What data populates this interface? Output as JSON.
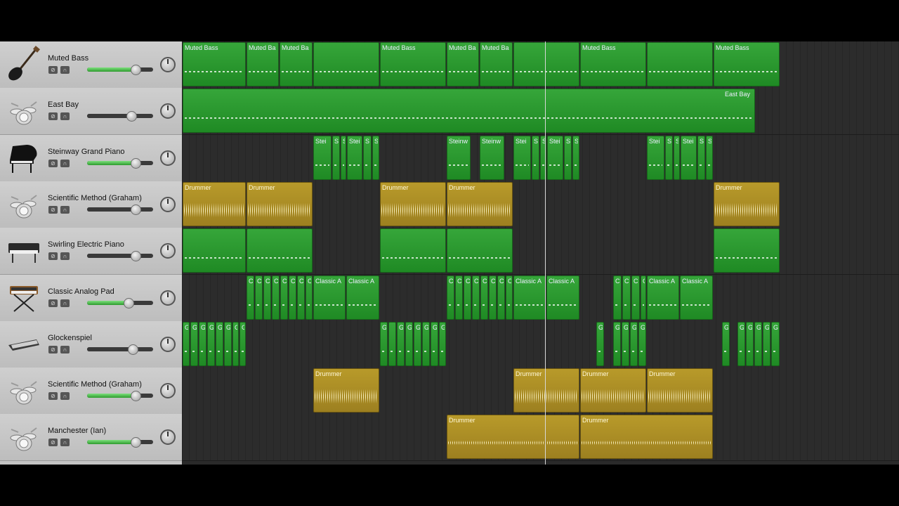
{
  "tracks": [
    {
      "name": "Muted Bass",
      "icon": "bass-guitar-icon",
      "volume": 0.72,
      "volume_color": "#44c444"
    },
    {
      "name": "East Bay",
      "icon": "drum-kit-icon",
      "volume": 0.66,
      "volume_color": "#3a3a3a"
    },
    {
      "name": "Steinway Grand Piano",
      "icon": "grand-piano-icon",
      "volume": 0.72,
      "volume_color": "#44c444"
    },
    {
      "name": "Scientific Method (Graham)",
      "icon": "drum-kit-icon",
      "volume": 0.72,
      "volume_color": "#3a3a3a"
    },
    {
      "name": "Swirling Electric Piano",
      "icon": "electric-piano-icon",
      "volume": 0.72,
      "volume_color": "#3a3a3a"
    },
    {
      "name": "Classic Analog Pad",
      "icon": "synth-keyboard-icon",
      "volume": 0.62,
      "volume_color": "#44c444"
    },
    {
      "name": "Glockenspiel",
      "icon": "glockenspiel-icon",
      "volume": 0.68,
      "volume_color": "#3a3a3a"
    },
    {
      "name": "Scientific Method (Graham)",
      "icon": "drum-kit-icon",
      "volume": 0.72,
      "volume_color": "#44c444"
    },
    {
      "name": "Manchester (Ian)",
      "icon": "drum-kit-icon",
      "volume": 0.72,
      "volume_color": "#44c444"
    }
  ],
  "regions": [
    [
      {
        "label": "Muted Bass",
        "type": "green",
        "start": 0,
        "end": 90
      },
      {
        "label": "Muted Ba",
        "type": "green",
        "start": 91,
        "end": 137
      },
      {
        "label": "Muted Ba",
        "type": "green",
        "start": 138,
        "end": 185
      },
      {
        "label": "",
        "type": "green",
        "start": 186,
        "end": 280
      },
      {
        "label": "Muted Bass",
        "type": "green",
        "start": 281,
        "end": 375
      },
      {
        "label": "Muted Ba",
        "type": "green",
        "start": 376,
        "end": 422
      },
      {
        "label": "Muted Ba",
        "type": "green",
        "start": 423,
        "end": 470
      },
      {
        "label": "",
        "type": "green",
        "start": 471,
        "end": 565
      },
      {
        "label": "Muted Bass",
        "type": "green",
        "start": 566,
        "end": 660
      },
      {
        "label": "",
        "type": "green",
        "start": 661,
        "end": 755
      },
      {
        "label": "Muted Bass",
        "type": "green",
        "start": 756,
        "end": 850
      }
    ],
    [
      {
        "label": "East Bay",
        "type": "green",
        "start": 0,
        "end": 815,
        "label_right": true
      }
    ],
    [
      {
        "label": "Stei",
        "type": "green",
        "start": 186,
        "end": 212
      },
      {
        "label": "S",
        "type": "green",
        "start": 213,
        "end": 224
      },
      {
        "label": "S",
        "type": "green",
        "start": 225,
        "end": 233
      },
      {
        "label": "Stei",
        "type": "green",
        "start": 234,
        "end": 256
      },
      {
        "label": "S",
        "type": "green",
        "start": 257,
        "end": 269
      },
      {
        "label": "S",
        "type": "green",
        "start": 270,
        "end": 280
      },
      {
        "label": "Steinw",
        "type": "green",
        "start": 376,
        "end": 410
      },
      {
        "label": "Steinw",
        "type": "green",
        "start": 423,
        "end": 458
      },
      {
        "label": "Stei",
        "type": "green",
        "start": 471,
        "end": 496
      },
      {
        "label": "S",
        "type": "green",
        "start": 497,
        "end": 508
      },
      {
        "label": "S",
        "type": "green",
        "start": 509,
        "end": 518
      },
      {
        "label": "Stei",
        "type": "green",
        "start": 519,
        "end": 542
      },
      {
        "label": "S",
        "type": "green",
        "start": 543,
        "end": 554
      },
      {
        "label": "S",
        "type": "green",
        "start": 555,
        "end": 565
      },
      {
        "label": "Stei",
        "type": "green",
        "start": 661,
        "end": 686
      },
      {
        "label": "S",
        "type": "green",
        "start": 687,
        "end": 698
      },
      {
        "label": "S",
        "type": "green",
        "start": 699,
        "end": 708
      },
      {
        "label": "Stei",
        "type": "green",
        "start": 709,
        "end": 732
      },
      {
        "label": "S",
        "type": "green",
        "start": 733,
        "end": 744
      },
      {
        "label": "S",
        "type": "green",
        "start": 745,
        "end": 755
      }
    ],
    [
      {
        "label": "Drummer",
        "type": "gold",
        "start": 0,
        "end": 90
      },
      {
        "label": "Drummer",
        "type": "gold",
        "start": 91,
        "end": 185
      },
      {
        "label": "Drummer",
        "type": "gold",
        "start": 281,
        "end": 375
      },
      {
        "label": "Drummer",
        "type": "gold",
        "start": 376,
        "end": 470
      },
      {
        "label": "Drummer",
        "type": "gold",
        "start": 756,
        "end": 850
      }
    ],
    [
      {
        "label": "",
        "type": "green",
        "start": 0,
        "end": 90
      },
      {
        "label": "",
        "type": "green",
        "start": 91,
        "end": 185
      },
      {
        "label": "",
        "type": "green",
        "start": 281,
        "end": 375
      },
      {
        "label": "",
        "type": "green",
        "start": 376,
        "end": 470
      },
      {
        "label": "",
        "type": "green",
        "start": 756,
        "end": 850
      }
    ],
    [
      {
        "label": "C",
        "type": "green",
        "start": 91,
        "end": 102
      },
      {
        "label": "C",
        "type": "green",
        "start": 103,
        "end": 114
      },
      {
        "label": "C",
        "type": "green",
        "start": 115,
        "end": 126
      },
      {
        "label": "C",
        "type": "green",
        "start": 127,
        "end": 138
      },
      {
        "label": "C",
        "type": "green",
        "start": 139,
        "end": 150
      },
      {
        "label": "C",
        "type": "green",
        "start": 151,
        "end": 162
      },
      {
        "label": "C",
        "type": "green",
        "start": 163,
        "end": 174
      },
      {
        "label": "C",
        "type": "green",
        "start": 175,
        "end": 185
      },
      {
        "label": "Classic A",
        "type": "green",
        "start": 186,
        "end": 232
      },
      {
        "label": "Classic A",
        "type": "green",
        "start": 233,
        "end": 280
      },
      {
        "label": "C",
        "type": "green",
        "start": 376,
        "end": 387
      },
      {
        "label": "C",
        "type": "green",
        "start": 388,
        "end": 399
      },
      {
        "label": "C",
        "type": "green",
        "start": 400,
        "end": 411
      },
      {
        "label": "C",
        "type": "green",
        "start": 412,
        "end": 423
      },
      {
        "label": "C",
        "type": "green",
        "start": 424,
        "end": 435
      },
      {
        "label": "C",
        "type": "green",
        "start": 436,
        "end": 447
      },
      {
        "label": "C",
        "type": "green",
        "start": 448,
        "end": 459
      },
      {
        "label": "C",
        "type": "green",
        "start": 460,
        "end": 470
      },
      {
        "label": "Classic A",
        "type": "green",
        "start": 471,
        "end": 517
      },
      {
        "label": "Classic A",
        "type": "green",
        "start": 518,
        "end": 565
      },
      {
        "label": "C",
        "type": "green",
        "start": 613,
        "end": 625
      },
      {
        "label": "C",
        "type": "green",
        "start": 626,
        "end": 638
      },
      {
        "label": "C",
        "type": "green",
        "start": 639,
        "end": 651
      },
      {
        "label": "C",
        "type": "green",
        "start": 652,
        "end": 660
      },
      {
        "label": "Classic A",
        "type": "green",
        "start": 661,
        "end": 707
      },
      {
        "label": "Classic A",
        "type": "green",
        "start": 708,
        "end": 755
      }
    ],
    [
      {
        "label": "G",
        "type": "green",
        "start": 0,
        "end": 10
      },
      {
        "label": "G",
        "type": "green",
        "start": 11,
        "end": 22
      },
      {
        "label": "G",
        "type": "green",
        "start": 23,
        "end": 34
      },
      {
        "label": "G",
        "type": "green",
        "start": 35,
        "end": 46
      },
      {
        "label": "G",
        "type": "green",
        "start": 47,
        "end": 58
      },
      {
        "label": "G",
        "type": "green",
        "start": 59,
        "end": 70
      },
      {
        "label": "G",
        "type": "green",
        "start": 71,
        "end": 80
      },
      {
        "label": "G",
        "type": "green",
        "start": 81,
        "end": 90
      },
      {
        "label": "G",
        "type": "green",
        "start": 281,
        "end": 292
      },
      {
        "label": "",
        "type": "green",
        "start": 293,
        "end": 304
      },
      {
        "label": "G",
        "type": "green",
        "start": 305,
        "end": 316
      },
      {
        "label": "G",
        "type": "green",
        "start": 317,
        "end": 328
      },
      {
        "label": "G",
        "type": "green",
        "start": 329,
        "end": 340
      },
      {
        "label": "G",
        "type": "green",
        "start": 341,
        "end": 352
      },
      {
        "label": "G",
        "type": "green",
        "start": 353,
        "end": 364
      },
      {
        "label": "G",
        "type": "green",
        "start": 365,
        "end": 375
      },
      {
        "label": "G",
        "type": "green",
        "start": 589,
        "end": 600
      },
      {
        "label": "G",
        "type": "green",
        "start": 613,
        "end": 624
      },
      {
        "label": "G",
        "type": "green",
        "start": 625,
        "end": 636
      },
      {
        "label": "G",
        "type": "green",
        "start": 637,
        "end": 648
      },
      {
        "label": "G",
        "type": "green",
        "start": 649,
        "end": 660
      },
      {
        "label": "G",
        "type": "green",
        "start": 768,
        "end": 779
      },
      {
        "label": "G",
        "type": "green",
        "start": 790,
        "end": 801
      },
      {
        "label": "G",
        "type": "green",
        "start": 802,
        "end": 813
      },
      {
        "label": "G",
        "type": "green",
        "start": 814,
        "end": 825
      },
      {
        "label": "G",
        "type": "green",
        "start": 826,
        "end": 837
      },
      {
        "label": "G",
        "type": "green",
        "start": 838,
        "end": 850
      }
    ],
    [
      {
        "label": "Drummer",
        "type": "gold",
        "start": 186,
        "end": 280
      },
      {
        "label": "Drummer",
        "type": "gold",
        "start": 471,
        "end": 565
      },
      {
        "label": "Drummer",
        "type": "gold",
        "start": 566,
        "end": 660
      },
      {
        "label": "Drummer",
        "type": "gold",
        "start": 661,
        "end": 755
      }
    ],
    [
      {
        "label": "Drummer",
        "type": "gold",
        "start": 376,
        "end": 565,
        "thin": true
      },
      {
        "label": "Drummer",
        "type": "gold",
        "start": 566,
        "end": 755,
        "thin": true
      }
    ]
  ],
  "playhead": 516
}
